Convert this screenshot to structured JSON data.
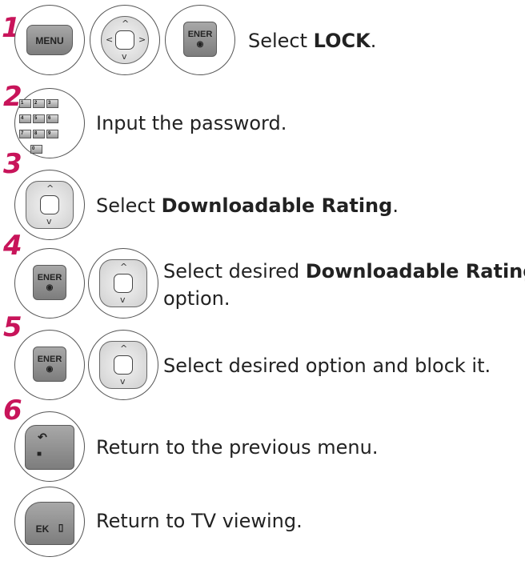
{
  "steps": [
    {
      "number": "1",
      "buttons": [
        "MENU",
        "nav",
        "ENTER"
      ],
      "text_pre": "Select ",
      "text_bold": "LOCK",
      "text_post": "."
    },
    {
      "number": "2",
      "buttons": [
        "keypad"
      ],
      "text_pre": "Input the password.",
      "text_bold": "",
      "text_post": ""
    },
    {
      "number": "3",
      "buttons": [
        "nav"
      ],
      "text_pre": "Select ",
      "text_bold": "Downloadable Rating",
      "text_post": "."
    },
    {
      "number": "4",
      "buttons": [
        "ENTER",
        "nav"
      ],
      "text_pre": "Select desired ",
      "text_bold": "Downloadable Rating",
      "text_post": "",
      "text_line2": "option."
    },
    {
      "number": "5",
      "buttons": [
        "ENTER",
        "nav"
      ],
      "text_pre": "Select desired option and block it.",
      "text_bold": "",
      "text_post": ""
    },
    {
      "number": "6",
      "buttons": [
        "BACK"
      ],
      "text_pre": "Return to the previous menu.",
      "text_bold": "",
      "text_post": ""
    },
    {
      "number": "",
      "buttons": [
        "EXIT"
      ],
      "text_pre": "Return to TV viewing.",
      "text_bold": "",
      "text_post": ""
    }
  ],
  "labels": {
    "menu": "MENU",
    "enter": "ENER",
    "enter_dot": "◉",
    "exit": "EK",
    "keypad_keys": [
      "1",
      "2",
      "3",
      "4",
      "5",
      "6",
      "7",
      "8",
      "9",
      "0"
    ]
  },
  "colors": {
    "step_number": "#c8145a"
  },
  "icons": [
    "menu-button-icon",
    "navigation-pad-icon",
    "enter-button-icon",
    "number-keypad-icon",
    "back-button-icon",
    "exit-button-icon"
  ]
}
